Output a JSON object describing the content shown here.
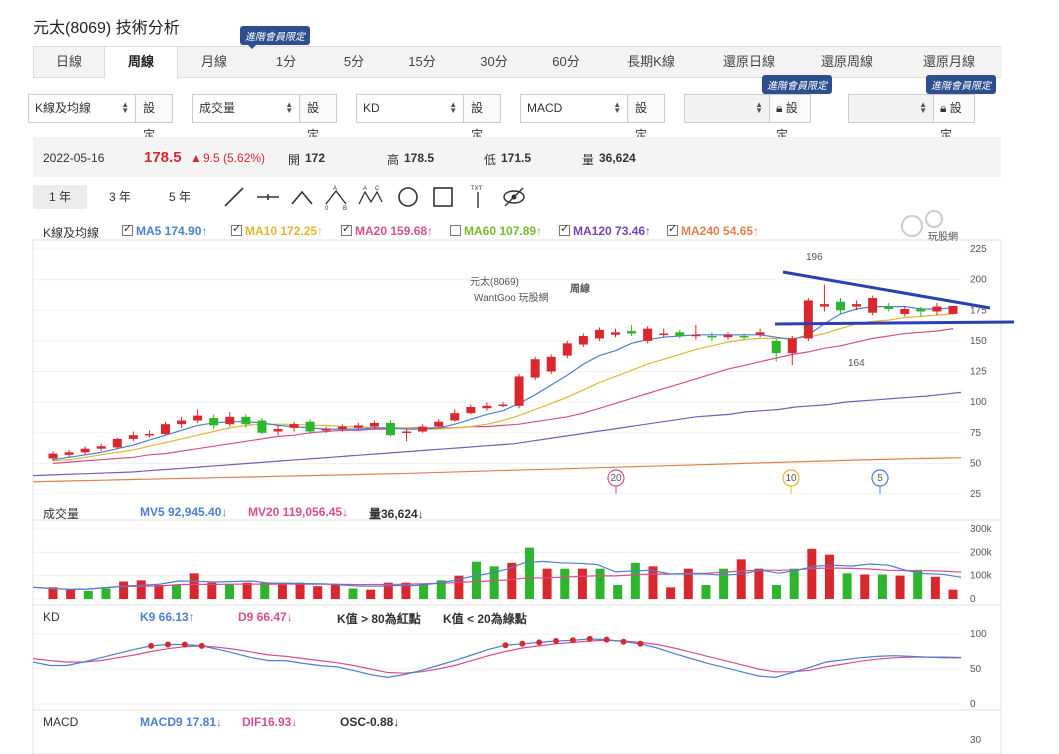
{
  "page": {
    "title": "元太(8069) 技術分析"
  },
  "period_tabs": [
    {
      "label": "日線",
      "active": false
    },
    {
      "label": "周線",
      "active": true
    },
    {
      "label": "月線",
      "active": false
    },
    {
      "label": "1分",
      "active": false
    },
    {
      "label": "5分",
      "active": false
    },
    {
      "label": "15分",
      "active": false
    },
    {
      "label": "30分",
      "active": false
    },
    {
      "label": "60分",
      "active": false
    },
    {
      "label": "長期K線",
      "active": false
    },
    {
      "label": "還原日線",
      "active": false
    },
    {
      "label": "還原周線",
      "active": false
    },
    {
      "label": "還原月線",
      "active": false
    }
  ],
  "vip_badge": "進階會員限定",
  "indicators": {
    "sel1": "K線及均線",
    "sel2": "成交量",
    "sel3": "KD",
    "sel4": "MACD",
    "settings_label": "設定"
  },
  "info": {
    "date": "2022-05-16",
    "price": "178.5",
    "change": "9.5 (5.62%)",
    "open_label": "開",
    "open": "172",
    "high_label": "高",
    "high": "178.5",
    "low_label": "低",
    "low": "171.5",
    "vol_label": "量",
    "vol": "36,624"
  },
  "ranges": [
    "1 年",
    "3 年",
    "5 年"
  ],
  "legend_k": {
    "title": "K線及均線",
    "ma5": "MA5 174.90↑",
    "ma10": "MA10 172.25↑",
    "ma20": "MA20 159.68↑",
    "ma60": "MA60 107.89↑",
    "ma120": "MA120 73.46↑",
    "ma240": "MA240 54.65↑"
  },
  "legend_vol": {
    "title": "成交量",
    "mv5": "MV5 92,945.40↓",
    "mv20": "MV20 119,056.45↓",
    "vol": "量36,624↓"
  },
  "legend_kd": {
    "title": "KD",
    "k9": "K9 66.13↑",
    "d9": "D9 66.47↓",
    "note1": "K值 > 80為紅點",
    "note2": "K值 < 20為綠點"
  },
  "legend_macd": {
    "title": "MACD",
    "macd9": "MACD9 17.81↓",
    "dif": "DIF16.93↓",
    "osc": "OSC-0.88↓"
  },
  "chart_watermark": {
    "name": "元太(8069)",
    "brand": "WantGoo 玩股網",
    "logo_text": "玩股網"
  },
  "annotations": {
    "period": "周線",
    "upper": "196",
    "lower": "164"
  },
  "markers": [
    "20",
    "10",
    "5"
  ],
  "colors": {
    "up": "#d9272e",
    "down": "#2db52d",
    "ma5": "#4a7fd4",
    "ma10": "#e3b531",
    "ma20": "#d64f8c",
    "ma60": "#7b5bb5",
    "ma120": "#7b3fb5",
    "ma240": "#e0804a",
    "annot": "#2b3fb3"
  },
  "chart_data": [
    {
      "type": "candlestick",
      "title": "元太(8069)",
      "ylim": [
        25,
        225
      ],
      "yticks": [
        225,
        200,
        175,
        150,
        125,
        100,
        75,
        50,
        25
      ],
      "candles": [
        {
          "o": 54,
          "c": 58,
          "h": 60,
          "l": 52
        },
        {
          "o": 57,
          "c": 59,
          "h": 61,
          "l": 55
        },
        {
          "o": 59,
          "c": 62,
          "h": 64,
          "l": 57
        },
        {
          "o": 62,
          "c": 64,
          "h": 66,
          "l": 60
        },
        {
          "o": 63,
          "c": 70,
          "h": 71,
          "l": 62
        },
        {
          "o": 70,
          "c": 73,
          "h": 76,
          "l": 68
        },
        {
          "o": 73,
          "c": 74,
          "h": 77,
          "l": 71
        },
        {
          "o": 74,
          "c": 82,
          "h": 84,
          "l": 73
        },
        {
          "o": 82,
          "c": 85,
          "h": 88,
          "l": 79
        },
        {
          "o": 85,
          "c": 89,
          "h": 94,
          "l": 83
        },
        {
          "o": 87,
          "c": 81,
          "h": 90,
          "l": 78
        },
        {
          "o": 82,
          "c": 88,
          "h": 92,
          "l": 80
        },
        {
          "o": 88,
          "c": 82,
          "h": 90,
          "l": 79
        },
        {
          "o": 85,
          "c": 75,
          "h": 87,
          "l": 74
        },
        {
          "o": 76,
          "c": 78,
          "h": 81,
          "l": 73
        },
        {
          "o": 79,
          "c": 82,
          "h": 84,
          "l": 76
        },
        {
          "o": 84,
          "c": 76,
          "h": 86,
          "l": 74
        },
        {
          "o": 77,
          "c": 78,
          "h": 80,
          "l": 75
        },
        {
          "o": 78,
          "c": 80,
          "h": 82,
          "l": 76
        },
        {
          "o": 79,
          "c": 81,
          "h": 83,
          "l": 77
        },
        {
          "o": 80,
          "c": 83,
          "h": 85,
          "l": 78
        },
        {
          "o": 83,
          "c": 73,
          "h": 85,
          "l": 72
        },
        {
          "o": 75,
          "c": 76,
          "h": 78,
          "l": 68
        },
        {
          "o": 76,
          "c": 80,
          "h": 82,
          "l": 75
        },
        {
          "o": 80,
          "c": 84,
          "h": 86,
          "l": 79
        },
        {
          "o": 85,
          "c": 91,
          "h": 94,
          "l": 84
        },
        {
          "o": 91,
          "c": 96,
          "h": 98,
          "l": 90
        },
        {
          "o": 95,
          "c": 97,
          "h": 100,
          "l": 93
        },
        {
          "o": 97,
          "c": 98,
          "h": 100,
          "l": 96
        },
        {
          "o": 97,
          "c": 121,
          "h": 123,
          "l": 95
        },
        {
          "o": 120,
          "c": 135,
          "h": 137,
          "l": 118
        },
        {
          "o": 125,
          "c": 137,
          "h": 139,
          "l": 123
        },
        {
          "o": 138,
          "c": 148,
          "h": 150,
          "l": 136
        },
        {
          "o": 147,
          "c": 154,
          "h": 156,
          "l": 145
        },
        {
          "o": 152,
          "c": 159,
          "h": 161,
          "l": 150
        },
        {
          "o": 155,
          "c": 157,
          "h": 160,
          "l": 153
        },
        {
          "o": 158,
          "c": 156,
          "h": 163,
          "l": 154
        },
        {
          "o": 150,
          "c": 160,
          "h": 162,
          "l": 148
        },
        {
          "o": 155,
          "c": 156,
          "h": 160,
          "l": 153
        },
        {
          "o": 157,
          "c": 154,
          "h": 159,
          "l": 152
        },
        {
          "o": 154,
          "c": 155,
          "h": 163,
          "l": 151
        },
        {
          "o": 154,
          "c": 153,
          "h": 157,
          "l": 150
        },
        {
          "o": 153,
          "c": 155,
          "h": 157,
          "l": 151
        },
        {
          "o": 154,
          "c": 153,
          "h": 156,
          "l": 151
        },
        {
          "o": 155,
          "c": 157,
          "h": 160,
          "l": 153
        },
        {
          "o": 150,
          "c": 140,
          "h": 152,
          "l": 133
        },
        {
          "o": 140,
          "c": 152,
          "h": 154,
          "l": 130
        },
        {
          "o": 152,
          "c": 183,
          "h": 185,
          "l": 150
        },
        {
          "o": 178,
          "c": 180,
          "h": 196,
          "l": 174
        },
        {
          "o": 182,
          "c": 175,
          "h": 185,
          "l": 172
        },
        {
          "o": 178,
          "c": 180,
          "h": 183,
          "l": 175
        },
        {
          "o": 173,
          "c": 185,
          "h": 187,
          "l": 171
        },
        {
          "o": 178,
          "c": 176,
          "h": 181,
          "l": 174
        },
        {
          "o": 172,
          "c": 176,
          "h": 178,
          "l": 170
        },
        {
          "o": 176,
          "c": 174,
          "h": 178,
          "l": 170
        },
        {
          "o": 174,
          "c": 178,
          "h": 181,
          "l": 171
        },
        {
          "o": 172,
          "c": 178.5,
          "h": 178.5,
          "l": 171.5
        }
      ],
      "ma5": [
        53,
        55,
        57,
        59,
        62,
        65,
        69,
        73,
        77,
        81,
        83,
        84,
        84,
        83,
        81,
        80,
        79,
        78,
        78,
        78,
        79,
        79,
        78,
        78,
        79,
        82,
        86,
        90,
        93,
        99,
        106,
        114,
        122,
        131,
        138,
        142,
        148,
        151,
        153,
        154,
        155,
        155,
        155,
        155,
        155,
        153,
        151,
        155,
        164,
        172,
        176,
        178,
        178,
        178,
        176,
        176,
        177
      ],
      "ma10": [
        52,
        53,
        55,
        57,
        59,
        61,
        64,
        67,
        70,
        73,
        76,
        79,
        81,
        82,
        82,
        82,
        81,
        81,
        80,
        80,
        79,
        79,
        79,
        78,
        78,
        79,
        80,
        82,
        85,
        89,
        94,
        99,
        104,
        110,
        116,
        121,
        126,
        131,
        135,
        139,
        143,
        146,
        149,
        151,
        152,
        152,
        152,
        153,
        156,
        160,
        164,
        166,
        167,
        169,
        170,
        171,
        172
      ],
      "ma20": [
        50,
        51,
        52,
        53,
        54,
        55,
        57,
        58,
        60,
        62,
        64,
        66,
        68,
        70,
        72,
        73,
        75,
        76,
        77,
        77,
        78,
        78,
        79,
        79,
        79,
        79,
        80,
        80,
        81,
        82,
        84,
        86,
        88,
        91,
        95,
        99,
        103,
        107,
        111,
        115,
        119,
        123,
        127,
        130,
        133,
        136,
        139,
        141,
        144,
        146,
        149,
        152,
        154,
        156,
        157,
        158,
        160
      ],
      "ma60": [
        40,
        40.5,
        41,
        41.5,
        42,
        42.5,
        43,
        44,
        45,
        46,
        47,
        48,
        49,
        50,
        51,
        52,
        53,
        54,
        55,
        56,
        57,
        58,
        59,
        60,
        61,
        62,
        63,
        64,
        65,
        66,
        68,
        70,
        72,
        74,
        76,
        78,
        80,
        82,
        84,
        86,
        88,
        89,
        90,
        92,
        93,
        94,
        96,
        97,
        98,
        100,
        101,
        102,
        103,
        104,
        105,
        106.5,
        107.9
      ],
      "ma240": [
        35,
        35.3,
        35.6,
        35.9,
        36.2,
        36.5,
        36.8,
        37.1,
        37.4,
        37.7,
        38,
        38.3,
        38.6,
        38.9,
        39.2,
        39.5,
        39.8,
        40.1,
        40.4,
        40.7,
        41,
        41.3,
        41.6,
        42,
        42.4,
        42.8,
        43.2,
        43.6,
        44,
        44.4,
        44.8,
        45.2,
        45.6,
        46,
        46.4,
        46.8,
        47.2,
        47.6,
        48,
        48.4,
        48.8,
        49.2,
        49.6,
        50,
        50.4,
        50.8,
        51.2,
        51.6,
        52,
        52.4,
        52.8,
        53.2,
        53.5,
        53.8,
        54.1,
        54.4,
        54.65
      ],
      "annotation_lines": {
        "resistance_label": "196",
        "support_label": "164"
      }
    },
    {
      "type": "bar",
      "title": "成交量",
      "ylim": [
        0,
        300000
      ],
      "yticks": [
        "300k",
        "200k",
        "100k",
        "0"
      ],
      "values": [
        50,
        40,
        35,
        45,
        75,
        80,
        60,
        60,
        110,
        70,
        65,
        70,
        70,
        65,
        70,
        55,
        65,
        45,
        40,
        70,
        70,
        65,
        80,
        100,
        160,
        140,
        155,
        220,
        130,
        130,
        130,
        130,
        60,
        155,
        140,
        50,
        130,
        60,
        130,
        170,
        130,
        60,
        130,
        215,
        190,
        110,
        105,
        105,
        100,
        125,
        95,
        40
      ]
    },
    {
      "type": "line",
      "title": "KD",
      "ylim": [
        0,
        100
      ],
      "yticks": [
        100,
        50,
        0
      ],
      "k": [
        60,
        55,
        55,
        60,
        66,
        72,
        78,
        83,
        85,
        85,
        83,
        78,
        72,
        66,
        62,
        62,
        58,
        55,
        53,
        48,
        42,
        38,
        42,
        48,
        55,
        62,
        70,
        78,
        84,
        86,
        88,
        90,
        91,
        93,
        92,
        89,
        86,
        80,
        72,
        65,
        58,
        52,
        46,
        40,
        38,
        45,
        52,
        60,
        63,
        66,
        68,
        69,
        68,
        67,
        66,
        66
      ],
      "d": [
        65,
        62,
        60,
        60,
        62,
        66,
        70,
        75,
        79,
        82,
        83,
        81,
        78,
        74,
        70,
        68,
        65,
        62,
        59,
        55,
        50,
        45,
        44,
        46,
        50,
        55,
        62,
        69,
        75,
        80,
        83,
        86,
        88,
        90,
        91,
        90,
        88,
        85,
        80,
        74,
        68,
        62,
        56,
        50,
        46,
        46,
        48,
        53,
        57,
        61,
        64,
        66,
        67,
        67,
        67,
        66.5
      ]
    }
  ]
}
